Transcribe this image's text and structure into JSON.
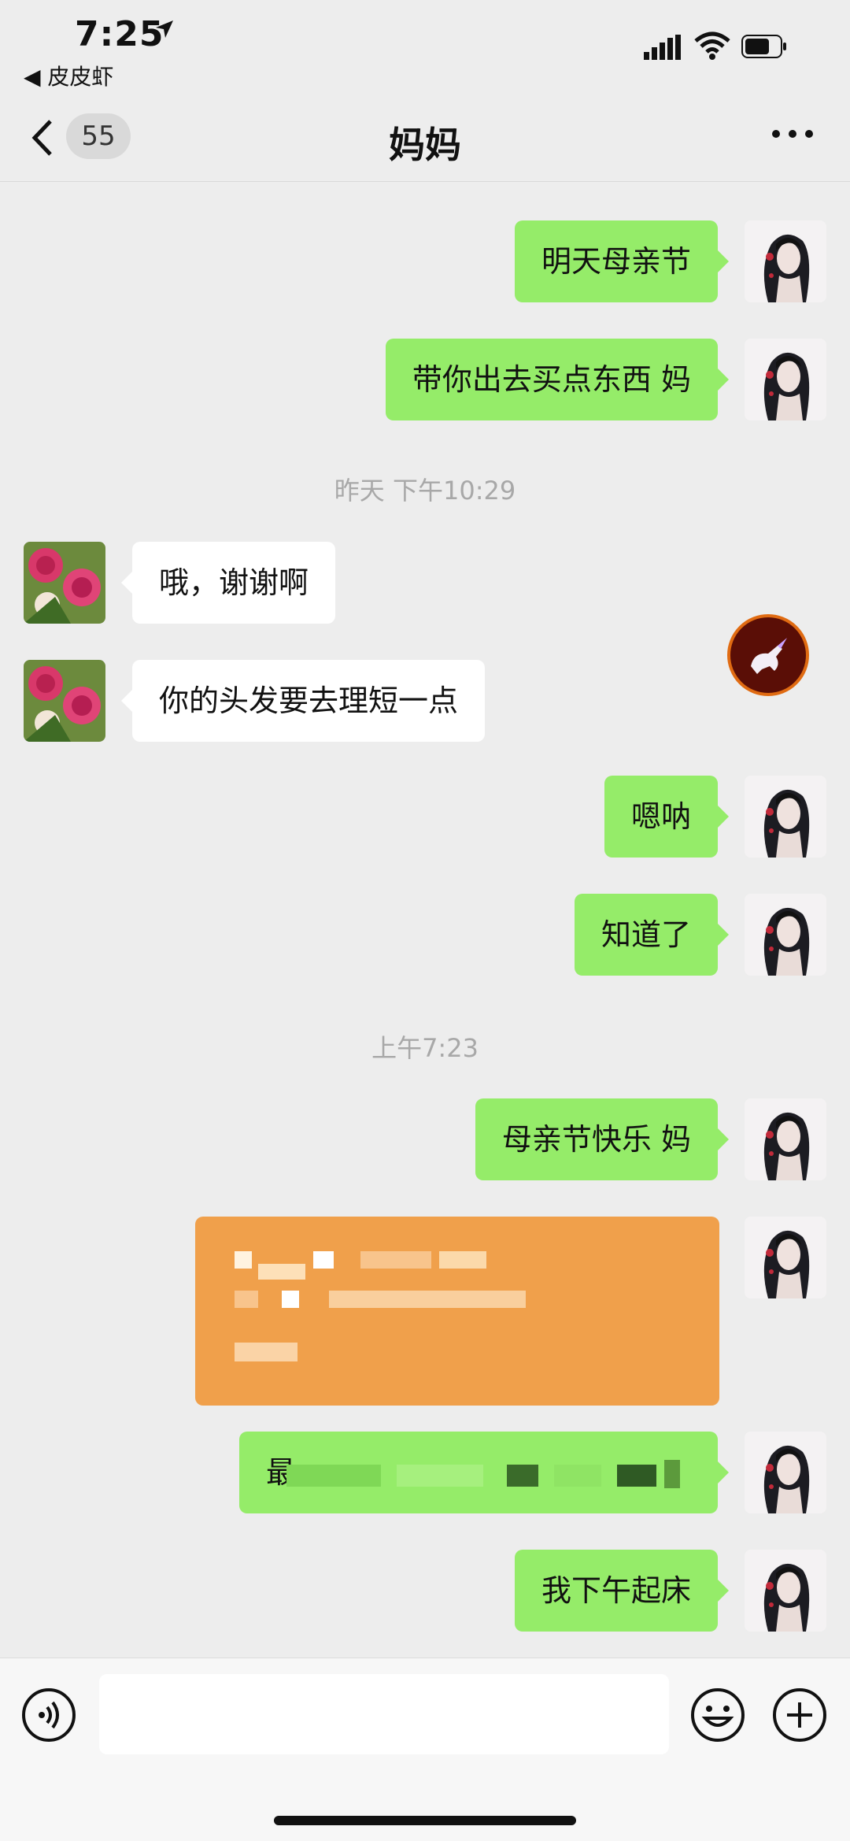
{
  "status_bar": {
    "time": "7:25",
    "back_app": "◀ 皮皮虾"
  },
  "nav": {
    "back_badge": "55",
    "title": "妈妈"
  },
  "messages": [
    {
      "side": "me",
      "text": "明天母亲节"
    },
    {
      "side": "me",
      "text": "带你出去买点东西 妈"
    },
    {
      "side": "other",
      "text": "哦，谢谢啊"
    },
    {
      "side": "other",
      "text": "你的头发要去理短一点"
    },
    {
      "side": "me",
      "text": "嗯呐"
    },
    {
      "side": "me",
      "text": "知道了"
    },
    {
      "side": "me",
      "text": "母亲节快乐 妈"
    },
    {
      "side": "me",
      "text": ""
    },
    {
      "side": "me",
      "text": "最"
    },
    {
      "side": "me",
      "text": "我下午起床"
    }
  ],
  "timestamps": [
    "昨天 下午10:29",
    "上午7:23"
  ],
  "input": {
    "value": "",
    "placeholder": ""
  },
  "colors": {
    "bubble_me": "#95ec69",
    "bubble_other": "#ffffff",
    "background": "#ededed",
    "highlight_bubble": "#f0a04b"
  },
  "icons": {
    "voice": "voice-icon",
    "emoji": "emoji-icon",
    "more": "plus-icon",
    "nav_more": "more-dots-icon",
    "float": "unicorn-badge-icon"
  }
}
